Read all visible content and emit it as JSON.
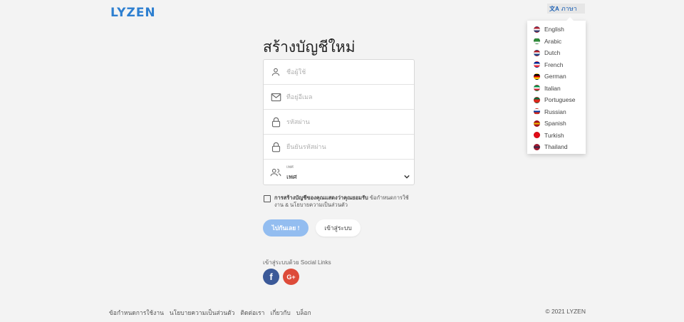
{
  "brand": {
    "logo": "LYZEN",
    "accent": "#2d7fd0"
  },
  "language": {
    "button_label": "ภาษา",
    "options": [
      {
        "label": "English",
        "flag": [
          "#b22234",
          "#ffffff",
          "#3c3b6e"
        ]
      },
      {
        "label": "Arabic",
        "flag": [
          "#2e8b3a",
          "#2e8b3a",
          "#ffffff"
        ]
      },
      {
        "label": "Dutch",
        "flag": [
          "#ae1c28",
          "#ffffff",
          "#21468b"
        ]
      },
      {
        "label": "French",
        "flag": [
          "#002395",
          "#ffffff",
          "#ed2939"
        ]
      },
      {
        "label": "German",
        "flag": [
          "#000000",
          "#dd0000",
          "#ffce00"
        ]
      },
      {
        "label": "Italian",
        "flag": [
          "#009246",
          "#ffffff",
          "#ce2b37"
        ]
      },
      {
        "label": "Portuguese",
        "flag": [
          "#046a38",
          "#da291c",
          "#da291c"
        ]
      },
      {
        "label": "Russian",
        "flag": [
          "#ffffff",
          "#0039a6",
          "#d52b1e"
        ]
      },
      {
        "label": "Spanish",
        "flag": [
          "#aa151b",
          "#f1bf00",
          "#aa151b"
        ]
      },
      {
        "label": "Turkish",
        "flag": [
          "#e30a17",
          "#e30a17",
          "#e30a17"
        ]
      },
      {
        "label": "Thailand",
        "flag": [
          "#a51931",
          "#2d2a4a",
          "#a51931"
        ]
      }
    ]
  },
  "form": {
    "title": "สร้างบัญชีใหม่",
    "username_placeholder": "ชื่อผู้ใช้",
    "email_placeholder": "ที่อยู่อีเมล",
    "password_placeholder": "รหัสผ่าน",
    "confirm_password_placeholder": "ยืนยันรหัสผ่าน",
    "gender_label": "เพศ",
    "gender_value": "เพศ",
    "agree_bold": "การสร้างบัญชีของคุณแสดงว่าคุณยอมรับ",
    "agree_rest": " ข้อกำหนดการใช้งาน & นโยบายความเป็นส่วนตัว",
    "submit_label": "ไปกันเลย !",
    "login_label": "เข้าสู่ระบบ"
  },
  "social": {
    "label": "เข้าสู่ระบบด้วย Social Links",
    "facebook_glyph": "f",
    "google_glyph": "G+"
  },
  "footer": {
    "links": [
      "ข้อกำหนดการใช้งาน",
      "นโยบายความเป็นส่วนตัว",
      "ติดต่อเรา",
      "เกี่ยวกับ",
      "บล็อก"
    ],
    "copyright": "© 2021 LYZEN"
  }
}
